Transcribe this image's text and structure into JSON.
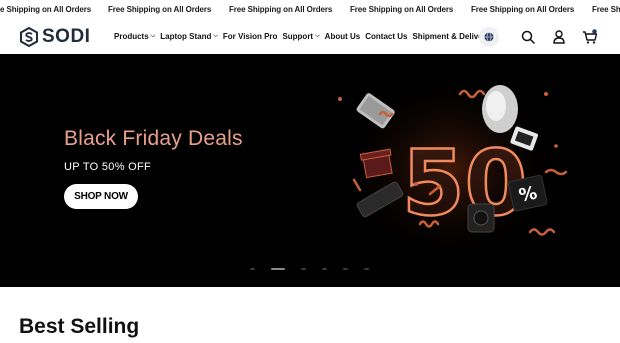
{
  "announcement": {
    "items": [
      "e Shipping on All Orders",
      "Free Shipping on All Orders",
      "Free Shipping on All Orders",
      "Free Shipping on All Orders",
      "Free Shipping on All Orders",
      "Free Shi"
    ]
  },
  "header": {
    "logo_text": "SODI",
    "nav": [
      {
        "label": "Products",
        "has_dropdown": true
      },
      {
        "label": "Laptop Stand",
        "has_dropdown": true
      },
      {
        "label": "For Vision Pro",
        "has_dropdown": false
      },
      {
        "label": "Support",
        "has_dropdown": true
      },
      {
        "label": "About Us",
        "has_dropdown": false
      },
      {
        "label": "Contact Us",
        "has_dropdown": false
      },
      {
        "label": "Shipment & Delivery",
        "has_dropdown": false
      }
    ],
    "icons": [
      "globe-icon",
      "search-icon",
      "account-icon",
      "cart-icon"
    ],
    "cart_count": ""
  },
  "hero": {
    "title": "Black Friday Deals",
    "subtitle": "UP TO 50% OFF",
    "cta_label": "SHOP NOW",
    "promo_number": "50",
    "promo_symbol": "%",
    "slide_count": 6,
    "active_slide": 1
  },
  "best_selling": {
    "title": "Best Selling"
  },
  "colors": {
    "hero_bg": "#000000",
    "hero_title": "#e8a08c",
    "accent_copper": "#c9603a",
    "logo": "#222b3a"
  }
}
